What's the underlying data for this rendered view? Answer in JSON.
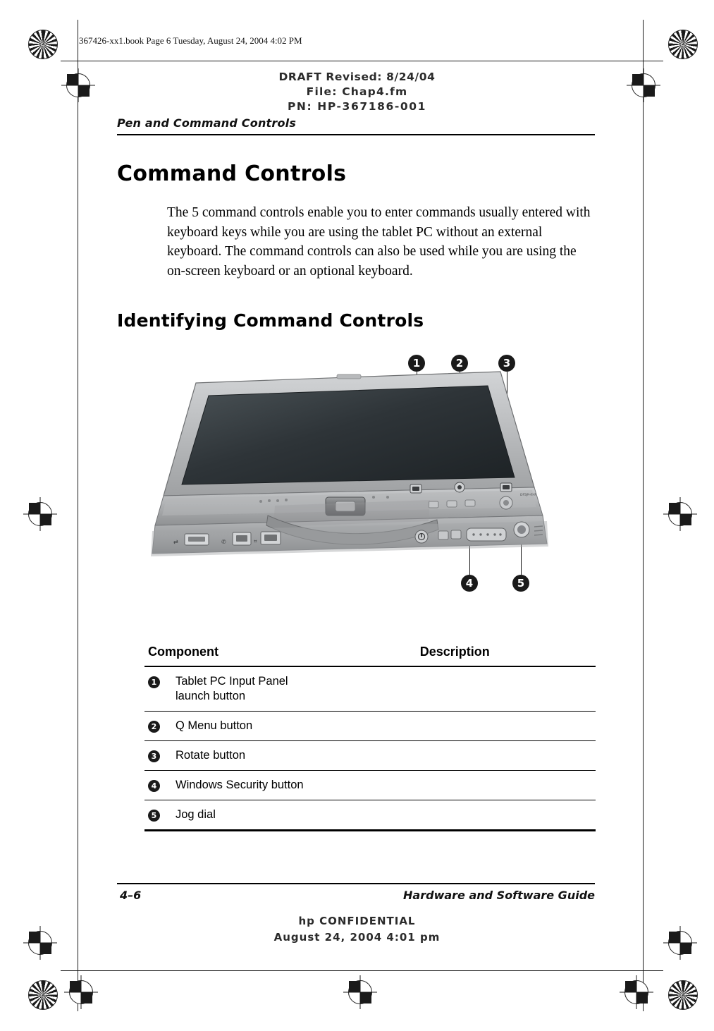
{
  "header_slug": "367426-xx1.book  Page 6  Tuesday, August 24, 2004  4:02 PM",
  "draft": {
    "line1": "DRAFT Revised: 8/24/04",
    "line2": "File: Chap4.fm",
    "line3": "PN: HP-367186-001"
  },
  "running_head": "Pen and Command Controls",
  "chapter_title": "Command Controls",
  "body_paragraph": "The 5 command controls enable you to enter commands usually entered with keyboard keys while you are using the tablet PC without an external keyboard. The command controls can also be used while you are using the on-screen keyboard or an optional keyboard.",
  "section_title": "Identifying Command Controls",
  "figure": {
    "callouts": [
      "1",
      "2",
      "3",
      "4",
      "5"
    ],
    "caption_code": "DFSJK-dsd"
  },
  "table": {
    "headers": {
      "component": "Component",
      "description": "Description"
    },
    "rows": [
      {
        "num": "1",
        "description": "Tablet PC Input Panel\nlaunch button"
      },
      {
        "num": "2",
        "description": "Q Menu button"
      },
      {
        "num": "3",
        "description": "Rotate button"
      },
      {
        "num": "4",
        "description": "Windows Security button"
      },
      {
        "num": "5",
        "description": "Jog dial"
      }
    ]
  },
  "footer": {
    "folio": "4–6",
    "guide_title": "Hardware and Software Guide",
    "confidential_line1": "hp CONFIDENTIAL",
    "confidential_line2": "August 24, 2004 4:01 pm"
  }
}
